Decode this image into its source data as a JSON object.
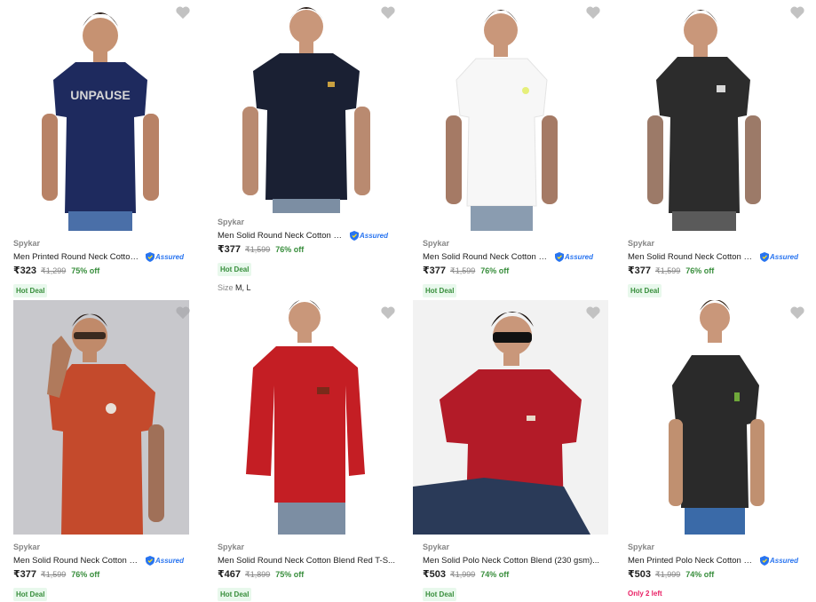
{
  "products": [
    {
      "brand": "Spykar",
      "title": "Men Printed Round Neck Cotton ...",
      "assured": "Assured",
      "price": "₹323",
      "mrp": "₹1,299",
      "discount": "75% off",
      "badge": "Hot Deal",
      "shirt_color": "#1e2a5e",
      "bg": "#ffffff",
      "print": "UNPAUSE"
    },
    {
      "brand": "Spykar",
      "title": "Men Solid Round Neck Cotton Bl...",
      "assured": "Assured",
      "price": "₹377",
      "mrp": "₹1,599",
      "discount": "76% off",
      "badge": "Hot Deal",
      "size_label": "Size",
      "size_value": "M, L",
      "shirt_color": "#1a2033",
      "bg": "#ffffff"
    },
    {
      "brand": "Spykar",
      "title": "Men Solid Round Neck Cotton Bl...",
      "assured": "Assured",
      "price": "₹377",
      "mrp": "₹1,599",
      "discount": "76% off",
      "badge": "Hot Deal",
      "shirt_color": "#f7f7f7",
      "bg": "#ffffff"
    },
    {
      "brand": "Spykar",
      "title": "Men Solid Round Neck Cotton Bl...",
      "assured": "Assured",
      "price": "₹377",
      "mrp": "₹1,599",
      "discount": "76% off",
      "badge": "Hot Deal",
      "shirt_color": "#2c2c2c",
      "bg": "#ffffff"
    },
    {
      "brand": "Spykar",
      "title": "Men Solid Round Neck Cotton Bl...",
      "assured": "Assured",
      "price": "₹377",
      "mrp": "₹1,599",
      "discount": "76% off",
      "badge": "Hot Deal",
      "shirt_color": "#c44a2c",
      "bg": "#c8c8cc"
    },
    {
      "brand": "Spykar",
      "title": "Men Solid Round Neck Cotton Blend Red T-S...",
      "price": "₹467",
      "mrp": "₹1,899",
      "discount": "75% off",
      "badge": "Hot Deal",
      "shirt_color": "#c41e24",
      "bg": "#ffffff"
    },
    {
      "brand": "Spykar",
      "title": "Men Solid Polo Neck Cotton Blend (230 gsm)...",
      "price": "₹503",
      "mrp": "₹1,999",
      "discount": "74% off",
      "badge": "Hot Deal",
      "shirt_color": "#b31b28",
      "bg": "#f2f2f2"
    },
    {
      "brand": "Spykar",
      "title": "Men Printed Polo Neck Cotton Bl...",
      "assured": "Assured",
      "price": "₹503",
      "mrp": "₹1,999",
      "discount": "74% off",
      "stock_note": "Only 2 left",
      "shirt_color": "#2a2a2a",
      "bg": "#ffffff"
    }
  ]
}
